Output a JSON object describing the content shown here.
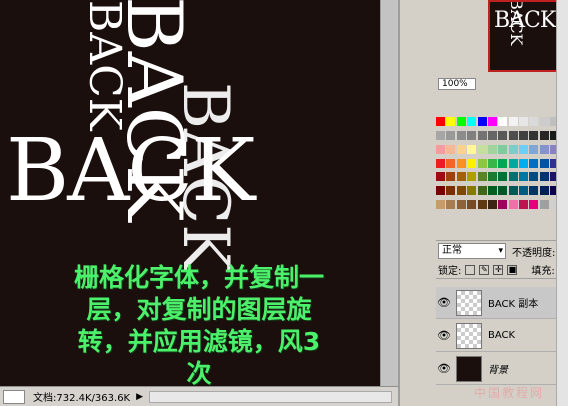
{
  "canvas": {
    "main_text": "BACK",
    "rotated_text_1": "BACK",
    "rotated_text_2": "BACK",
    "overlap_text": "BACK"
  },
  "caption": {
    "line1": "栅格化字体，并复制一",
    "line2": "层，对复制的图层旋",
    "line3": "转，并应用滤镜，风3",
    "line4": "次"
  },
  "status_bar": {
    "doc_size": "文档:732.4K/363.6K",
    "arrow": "▶"
  },
  "navigator": {
    "thumb_text": "BACK",
    "thumb_rot_text": "BACK",
    "zoom_value": "100%"
  },
  "swatches": {
    "colors": [
      "#ff0000",
      "#ffff00",
      "#00ff00",
      "#00ffff",
      "#0000ff",
      "#ff00ff",
      "#ffffff",
      "#f2f2f2",
      "#e6e6e6",
      "#d9d9d9",
      "#cccccc",
      "#bfbfbf",
      "#b3b3b3",
      "#a6a6a6",
      "#999999",
      "#8c8c8c",
      "#808080",
      "#737373",
      "#666666",
      "#595959",
      "#4d4d4d",
      "#404040",
      "#333333",
      "#262626",
      "#1a1a1a",
      "#000000",
      "#f29c9c",
      "#f5b895",
      "#fbd28c",
      "#fff799",
      "#c4df9b",
      "#a2d39c",
      "#82ca9d",
      "#7bcdc8",
      "#6ecff6",
      "#7ea7d8",
      "#8493ca",
      "#8882be",
      "#a187be",
      "#ed1c24",
      "#f26522",
      "#f7941d",
      "#fff200",
      "#8dc73f",
      "#39b54a",
      "#00a651",
      "#00a99d",
      "#00aeef",
      "#0072bc",
      "#0054a6",
      "#2e3192",
      "#662d91",
      "#9e0b0f",
      "#a0410d",
      "#a36209",
      "#aba000",
      "#598527",
      "#197b30",
      "#007236",
      "#00746b",
      "#0076a3",
      "#004b80",
      "#003471",
      "#1b1464",
      "#440e62",
      "#790000",
      "#7b2e00",
      "#7d4900",
      "#827b00",
      "#406618",
      "#005e20",
      "#005826",
      "#005952",
      "#005b7f",
      "#003663",
      "#002157",
      "#0d004c",
      "#32004b",
      "#c69c6d",
      "#a67c52",
      "#8c6239",
      "#754c24",
      "#603913",
      "#3c2415",
      "#9e005d",
      "#f06eaa",
      "#bd1550",
      "#e6007e",
      "#a0a0a0",
      "#cfcfcf",
      "#ffffff"
    ]
  },
  "layers": {
    "blend_mode": "正常",
    "opacity_label": "不透明度:",
    "lock_label": "锁定:",
    "fill_label": "填充:",
    "items": [
      {
        "name": "BACK 副本"
      },
      {
        "name": "BACK"
      },
      {
        "name": "背景"
      }
    ]
  },
  "watermark": "中国教程网"
}
